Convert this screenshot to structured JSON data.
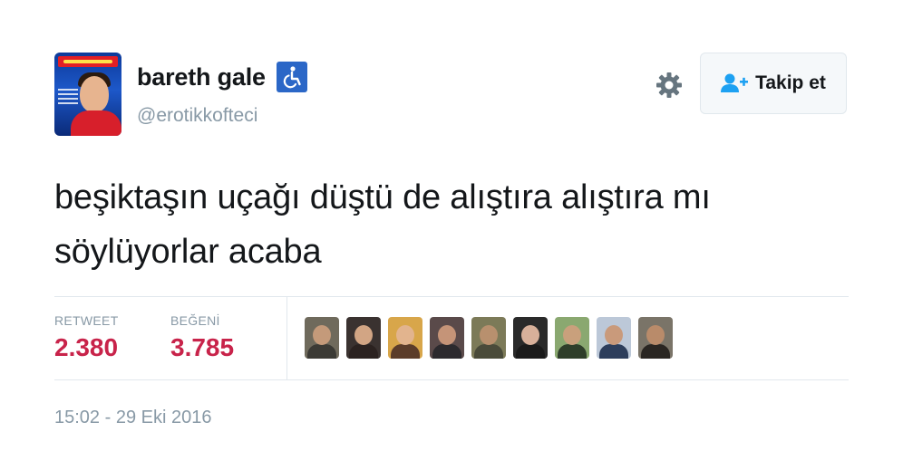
{
  "user": {
    "display_name": "bareth gale",
    "handle": "@erotikkofteci",
    "badge_icon": "wheelchair-icon",
    "avatar_icon": "profile-photo"
  },
  "header": {
    "settings_icon": "gear-icon",
    "follow_label": "Takip et",
    "follow_icon": "user-plus-icon"
  },
  "tweet": {
    "line1": "beşiktaşın uçağı düştü de alıştıra alıştıra mı",
    "line2": "söylüyorlar acaba",
    "timestamp": "15:02 - 29 Eki 2016"
  },
  "stats": {
    "retweet_label": "RETWEET",
    "retweet_count": "2.380",
    "like_label": "BEĞENİ",
    "like_count": "3.785"
  },
  "likers": [
    {
      "name": "liker-1",
      "bg": "#6f6a5c",
      "skin": "#c49a7a",
      "body": "#3b3a35"
    },
    {
      "name": "liker-2",
      "bg": "#3a3230",
      "skin": "#d2a584",
      "body": "#2b2220"
    },
    {
      "name": "liker-3",
      "bg": "#d8a64a",
      "skin": "#e2b48e",
      "body": "#5b3c2a"
    },
    {
      "name": "liker-4",
      "bg": "#5a4a4a",
      "skin": "#c59478",
      "body": "#2c2a2e"
    },
    {
      "name": "liker-5",
      "bg": "#7c7a58",
      "skin": "#b8906e",
      "body": "#4a4b3a"
    },
    {
      "name": "liker-6",
      "bg": "#2a2a2a",
      "skin": "#d8b09a",
      "body": "#1a1a1a"
    },
    {
      "name": "liker-7",
      "bg": "#8aa870",
      "skin": "#c9a07c",
      "body": "#2f3e2a"
    },
    {
      "name": "liker-8",
      "bg": "#bcc8d8",
      "skin": "#c99a7b",
      "body": "#2d3e5c"
    },
    {
      "name": "liker-9",
      "bg": "#7a7468",
      "skin": "#b98b6a",
      "body": "#2a2622"
    }
  ],
  "colors": {
    "stat_value": "#c8234a",
    "muted": "#8899a6",
    "badge": "#2b67c7"
  }
}
